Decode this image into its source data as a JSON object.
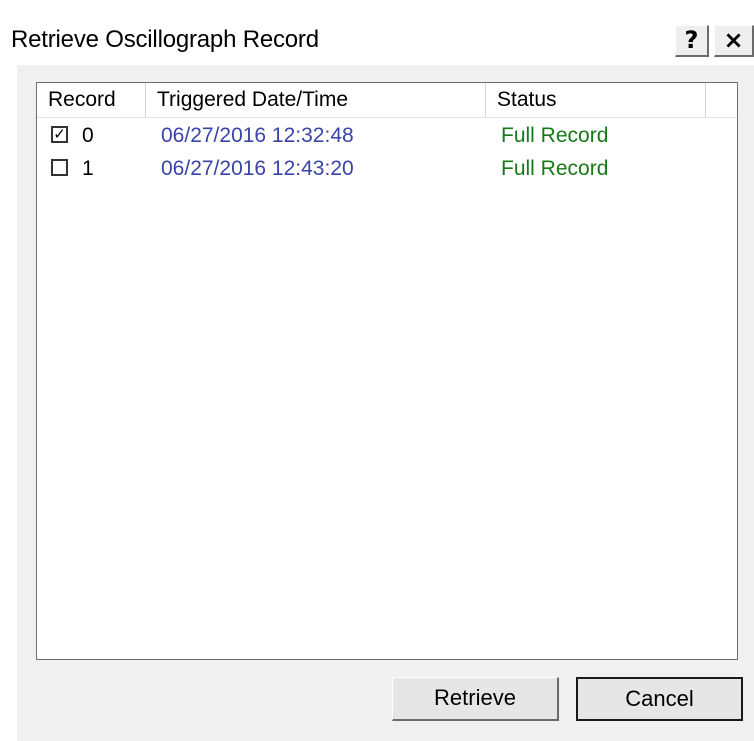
{
  "window": {
    "title": "Retrieve Oscillograph Record",
    "help_label": "?",
    "close_label": "×"
  },
  "list": {
    "columns": [
      "Record",
      "Triggered Date/Time",
      "Status",
      ""
    ],
    "rows": [
      {
        "checked": true,
        "check_mark": "✓",
        "record": "0",
        "datetime": "06/27/2016 12:32:48",
        "status": "Full Record"
      },
      {
        "checked": false,
        "check_mark": "",
        "record": "1",
        "datetime": "06/27/2016 12:43:20",
        "status": "Full Record"
      }
    ]
  },
  "buttons": {
    "retrieve_label": "Retrieve",
    "cancel_label": "Cancel"
  },
  "colors": {
    "datetime_text": "#3a44a8",
    "status_text": "#177a17"
  }
}
